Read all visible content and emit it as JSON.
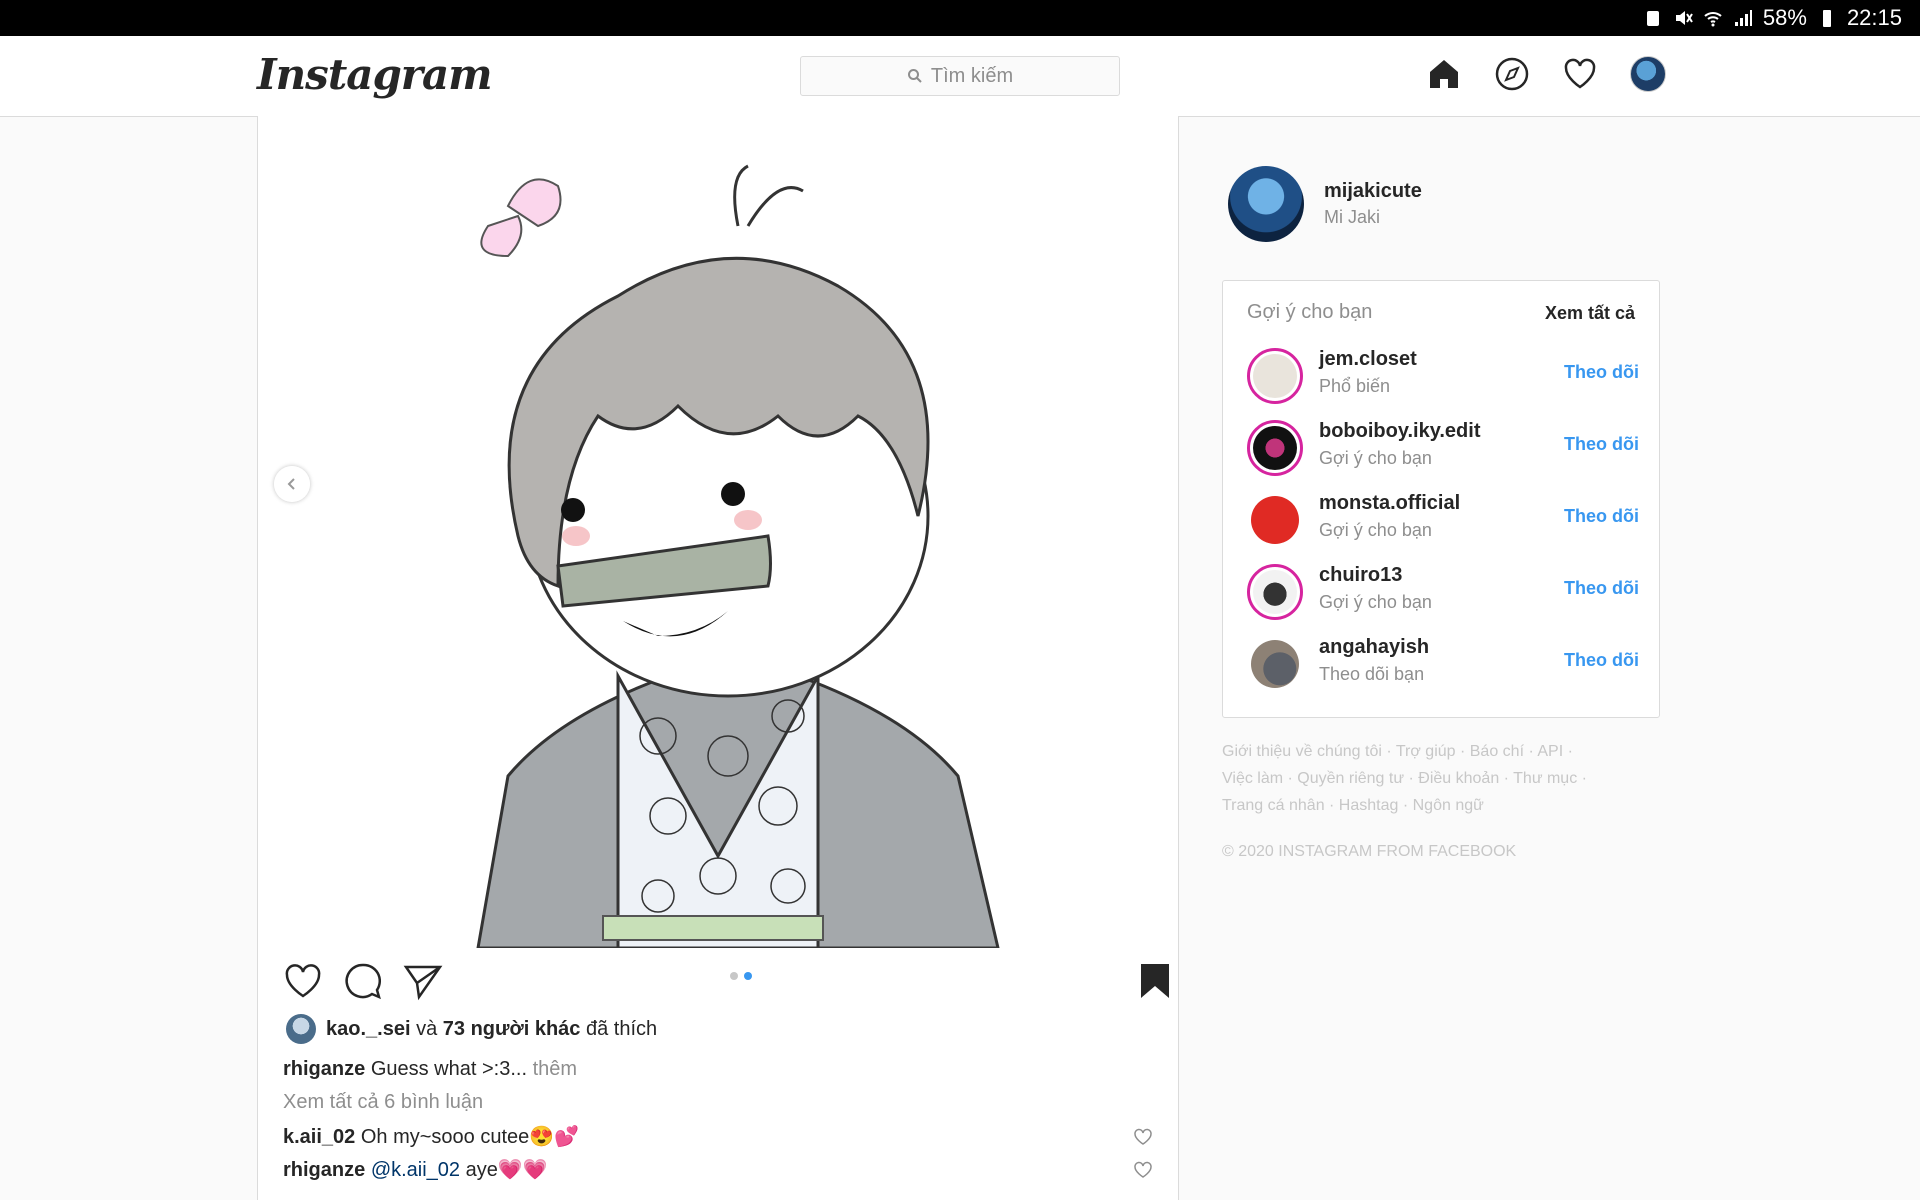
{
  "statusbar": {
    "battery": "58%",
    "time": "22:15"
  },
  "header": {
    "logo": "Instagram",
    "search_placeholder": "Tìm kiếm"
  },
  "post": {
    "likes_user": "kao._.sei",
    "likes_and": "và",
    "likes_others": "73 người khác",
    "likes_suffix": "đã thích",
    "caption_user": "rhiganze",
    "caption_text": "Guess what >:3...",
    "caption_more": "thêm",
    "view_all": "Xem tất cả 6 bình luận",
    "comments": [
      {
        "user": "k.aii_02",
        "text": "Oh my~sooo cutee😍💕"
      },
      {
        "user": "rhiganze",
        "mention": "@k.aii_02",
        "text": "aye💗💗"
      }
    ],
    "carousel": {
      "count": 2,
      "active": 2
    }
  },
  "profile": {
    "username": "mijakicute",
    "name": "Mi Jaki"
  },
  "suggestions": {
    "title": "Gợi ý cho bạn",
    "see_all": "Xem tất cả",
    "items": [
      {
        "username": "jem.closet",
        "sub": "Phổ biến",
        "action": "Theo dõi"
      },
      {
        "username": "boboiboy.iky.edit",
        "sub": "Gợi ý cho bạn",
        "action": "Theo dõi"
      },
      {
        "username": "monsta.official",
        "sub": "Gợi ý cho bạn",
        "action": "Theo dõi"
      },
      {
        "username": "chuiro13",
        "sub": "Gợi ý cho bạn",
        "action": "Theo dõi"
      },
      {
        "username": "angahayish",
        "sub": "Theo dõi bạn",
        "action": "Theo dõi"
      }
    ]
  },
  "footer": {
    "line1": "Giới thiệu về chúng tôi · Trợ giúp · Báo chí · API ·",
    "line2": "Việc làm · Quyền riêng tư · Điều khoản · Thư mục ·",
    "line3": "Trang cá nhân · Hashtag · Ngôn ngữ",
    "copyright": "© 2020 INSTAGRAM FROM FACEBOOK"
  },
  "colors": {
    "accent": "#3897f0",
    "border": "#dbdbdb",
    "muted": "#8e8e8e"
  }
}
